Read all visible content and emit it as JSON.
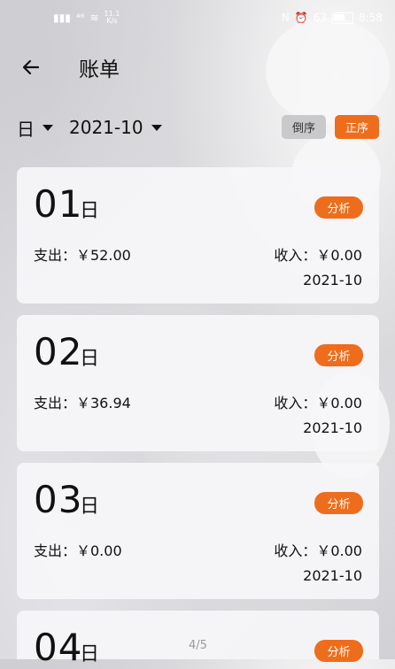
{
  "status_bar": {
    "left_text": "⁴⁶",
    "speed_value": "11.1",
    "speed_unit": "K/s",
    "battery_text": "63",
    "time": "8:58"
  },
  "header": {
    "title": "账单"
  },
  "filters": {
    "unit_label": "日",
    "month_label": "2021-10",
    "sort_desc_label": "倒序",
    "sort_asc_label": "正序"
  },
  "accent_color": "#ee6d1c",
  "cards": [
    {
      "day": "01",
      "unit": "日",
      "analyze": "分析",
      "expense": "支出：￥52.00",
      "income": "收入：￥0.00",
      "month": "2021-10"
    },
    {
      "day": "02",
      "unit": "日",
      "analyze": "分析",
      "expense": "支出：￥36.94",
      "income": "收入：￥0.00",
      "month": "2021-10"
    },
    {
      "day": "03",
      "unit": "日",
      "analyze": "分析",
      "expense": "支出：￥0.00",
      "income": "收入：￥0.00",
      "month": "2021-10"
    },
    {
      "day": "04",
      "unit": "日",
      "analyze": "分析"
    }
  ],
  "page_indicator": "4/5"
}
